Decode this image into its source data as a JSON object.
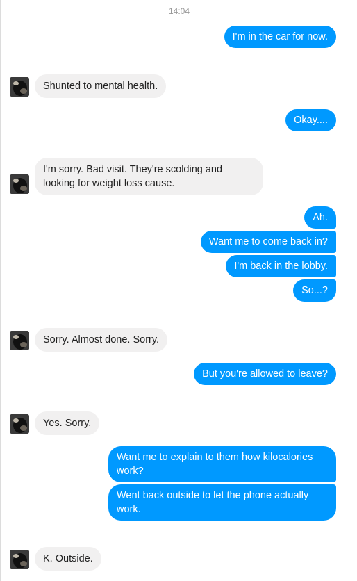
{
  "chat": {
    "timestamp": "14:04",
    "messages": [
      {
        "side": "out",
        "text": "I'm in the car for now."
      },
      {
        "side": "in",
        "text": "Shunted to mental health."
      },
      {
        "side": "out",
        "text": "Okay...."
      },
      {
        "side": "in",
        "text": "I'm sorry. Bad visit. They're scolding and looking for weight loss cause."
      },
      {
        "side": "out",
        "text": "Ah."
      },
      {
        "side": "out",
        "text": "Want me to come back in?"
      },
      {
        "side": "out",
        "text": "I'm back in the lobby."
      },
      {
        "side": "out",
        "text": "So...?"
      },
      {
        "side": "in",
        "text": "Sorry. Almost done. Sorry."
      },
      {
        "side": "out",
        "text": "But you're allowed to leave?"
      },
      {
        "side": "in",
        "text": "Yes. Sorry."
      },
      {
        "side": "out",
        "text": "Want me to explain to them how kilocalories work?"
      },
      {
        "side": "out",
        "text": "Went back outside to let the phone actually work."
      },
      {
        "side": "in",
        "text": "K. Outside."
      }
    ]
  },
  "avatar_icon": "contact-photo",
  "colors": {
    "outgoing_bubble": "#0099ff",
    "incoming_bubble": "#f1f0f0",
    "timestamp_text": "#999999"
  }
}
